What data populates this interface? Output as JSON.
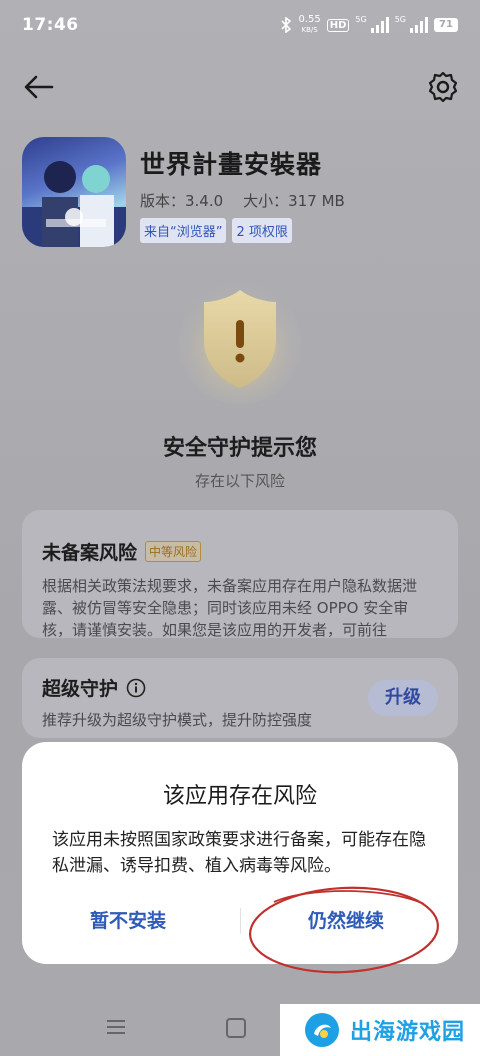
{
  "status_bar": {
    "time": "17:46",
    "net_speed_value": "0.55",
    "net_speed_unit": "KB/S",
    "hd_label": "HD",
    "signal1_label": "5G",
    "signal2_label": "5G",
    "battery": "71"
  },
  "app": {
    "name": "世界計畫安裝器",
    "version": "版本：3.4.0",
    "size": "大小：317 MB",
    "source_tag": "来自“浏览器”",
    "permissions_tag": "2 项权限"
  },
  "security": {
    "title": "安全守护提示您",
    "subtitle": "存在以下风险"
  },
  "risk_card": {
    "title": "未备案风险",
    "badge": "中等风险",
    "text": "根据相关政策法规要求，未备案应用存在用户隐私数据泄露、被仿冒等安全隐患；同时该应用未经 OPPO 安全审核，请谨慎安装。如果您是该应用的开发者，可前往"
  },
  "protection_card": {
    "title": "超级守护",
    "text": "推荐升级为超级守护模式，提升防控强度",
    "button": "升级"
  },
  "dialog": {
    "title": "该应用存在风险",
    "message": "该应用未按照国家政策要求进行备案，可能存在隐私泄漏、诱导扣费、植入病毒等风险。",
    "cancel": "暂不安装",
    "continue": "仍然继续"
  },
  "watermark": {
    "text": "出海游戏园"
  },
  "colors": {
    "accent": "#2f5bb8",
    "annotation": "#c0312e",
    "watermark": "#1ea1e4"
  }
}
